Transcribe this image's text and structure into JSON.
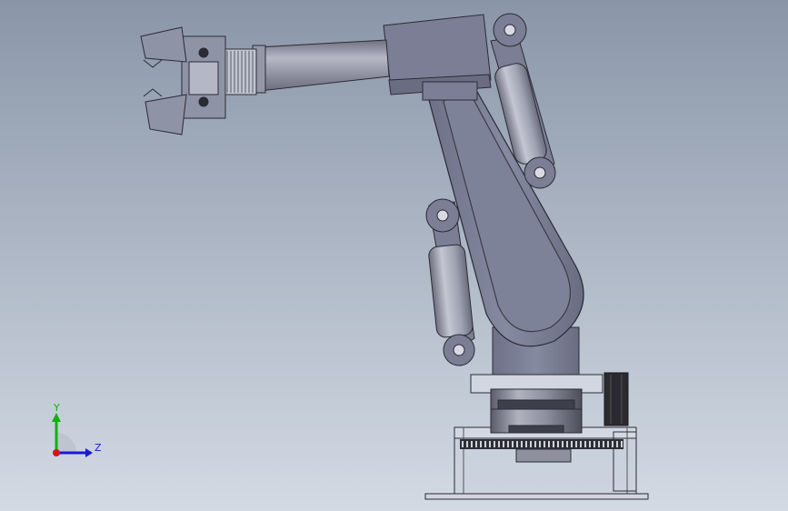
{
  "viewport": {
    "background_top": "#8a96a8",
    "background_bottom": "#d3dae4"
  },
  "model": {
    "part_colors": {
      "arm": "#7d8096",
      "arm_dark": "#5d6075",
      "cylinder": "#a8aab8",
      "pin": "#d8d9e2",
      "edge": "#2b2b35"
    }
  },
  "triad": {
    "y_label": "Y",
    "z_label": "Z",
    "y_color": "#12b012",
    "z_color": "#1a1ad0",
    "x_color": "#d01818"
  }
}
